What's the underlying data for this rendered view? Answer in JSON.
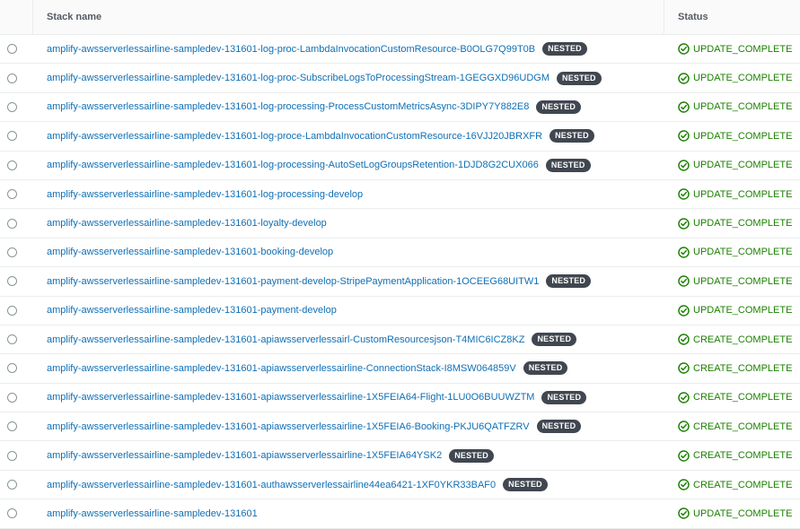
{
  "header": {
    "stack_name": "Stack name",
    "status": "Status"
  },
  "nested_badge": "NESTED",
  "rows": [
    {
      "name": "amplify-awsserverlessairline-sampledev-131601-log-proc-LambdaInvocationCustomResource-B0OLG7Q99T0B",
      "nested": true,
      "status": "UPDATE_COMPLETE"
    },
    {
      "name": "amplify-awsserverlessairline-sampledev-131601-log-proc-SubscribeLogsToProcessingStream-1GEGGXD96UDGM",
      "nested": true,
      "status": "UPDATE_COMPLETE"
    },
    {
      "name": "amplify-awsserverlessairline-sampledev-131601-log-processing-ProcessCustomMetricsAsync-3DIPY7Y882E8",
      "nested": true,
      "status": "UPDATE_COMPLETE"
    },
    {
      "name": "amplify-awsserverlessairline-sampledev-131601-log-proce-LambdaInvocationCustomResource-16VJJ20JBRXFR",
      "nested": true,
      "status": "UPDATE_COMPLETE"
    },
    {
      "name": "amplify-awsserverlessairline-sampledev-131601-log-processing-AutoSetLogGroupsRetention-1DJD8G2CUX066",
      "nested": true,
      "status": "UPDATE_COMPLETE"
    },
    {
      "name": "amplify-awsserverlessairline-sampledev-131601-log-processing-develop",
      "nested": false,
      "status": "UPDATE_COMPLETE"
    },
    {
      "name": "amplify-awsserverlessairline-sampledev-131601-loyalty-develop",
      "nested": false,
      "status": "UPDATE_COMPLETE"
    },
    {
      "name": "amplify-awsserverlessairline-sampledev-131601-booking-develop",
      "nested": false,
      "status": "UPDATE_COMPLETE"
    },
    {
      "name": "amplify-awsserverlessairline-sampledev-131601-payment-develop-StripePaymentApplication-1OCEEG68UITW1",
      "nested": true,
      "status": "UPDATE_COMPLETE"
    },
    {
      "name": "amplify-awsserverlessairline-sampledev-131601-payment-develop",
      "nested": false,
      "status": "UPDATE_COMPLETE"
    },
    {
      "name": "amplify-awsserverlessairline-sampledev-131601-apiawsserverlessairl-CustomResourcesjson-T4MIC6ICZ8KZ",
      "nested": true,
      "status": "CREATE_COMPLETE"
    },
    {
      "name": "amplify-awsserverlessairline-sampledev-131601-apiawsserverlessairline-ConnectionStack-I8MSW064859V",
      "nested": true,
      "status": "CREATE_COMPLETE"
    },
    {
      "name": "amplify-awsserverlessairline-sampledev-131601-apiawsserverlessairline-1X5FEIA64-Flight-1LU0O6BUUWZTM",
      "nested": true,
      "status": "CREATE_COMPLETE"
    },
    {
      "name": "amplify-awsserverlessairline-sampledev-131601-apiawsserverlessairline-1X5FEIA6-Booking-PKJU6QATFZRV",
      "nested": true,
      "status": "CREATE_COMPLETE"
    },
    {
      "name": "amplify-awsserverlessairline-sampledev-131601-apiawsserverlessairline-1X5FEIA64YSK2",
      "nested": true,
      "status": "CREATE_COMPLETE"
    },
    {
      "name": "amplify-awsserverlessairline-sampledev-131601-authawsserverlessairline44ea6421-1XF0YKR33BAF0",
      "nested": true,
      "status": "CREATE_COMPLETE"
    },
    {
      "name": "amplify-awsserverlessairline-sampledev-131601",
      "nested": false,
      "status": "UPDATE_COMPLETE"
    }
  ],
  "colors": {
    "link": "#0f6fb5",
    "success": "#1d8102",
    "badge_bg": "#414750"
  },
  "icons": {
    "status": "check-circle-icon",
    "select": "radio-button"
  }
}
